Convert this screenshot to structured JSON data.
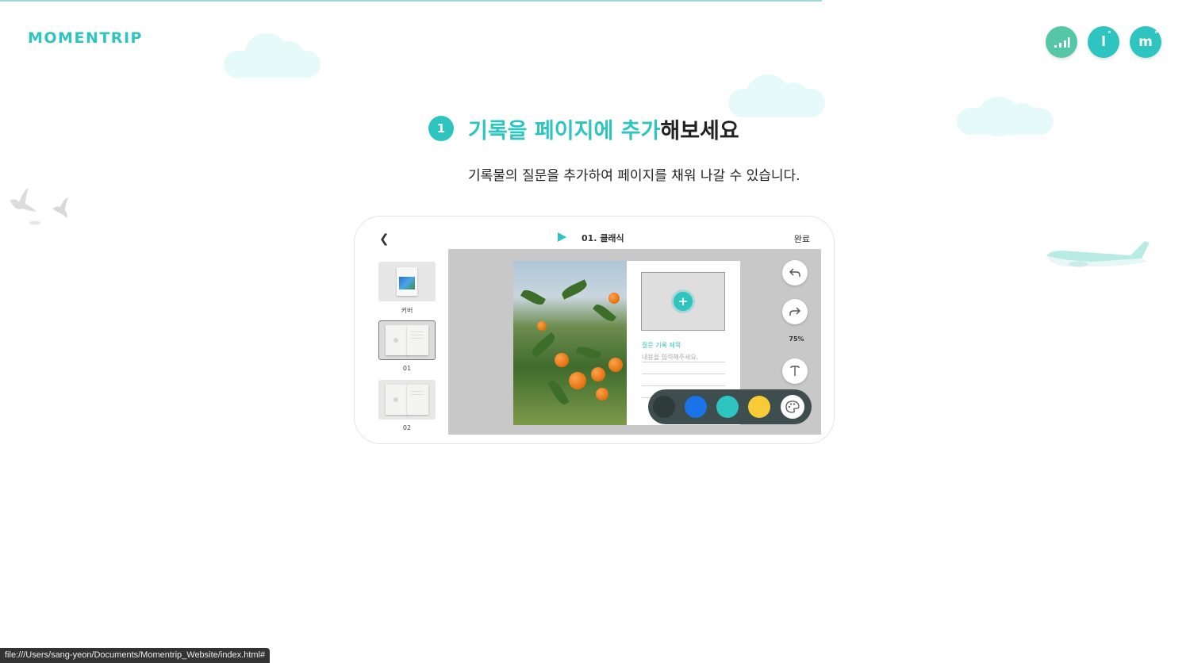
{
  "brand": {
    "logo": "MOMENTRIP"
  },
  "top_nav": {
    "stats_icon": "bar-chart-icon",
    "l_button_label": "l",
    "m_button_label": "m",
    "degree_mark": "°"
  },
  "section": {
    "step_number": "1",
    "title_highlight": "기록을 페이지에 추가",
    "title_rest": "해보세요",
    "subtitle": "기록물의 질문을 추가하여 페이지를 채워 나갈 수 있습니다."
  },
  "app": {
    "title": "01. 클래식",
    "done_label": "완료",
    "back_icon": "chevron-left-icon",
    "play_icon": "play-icon",
    "thumbnails": [
      {
        "label": "커버",
        "selected": false
      },
      {
        "label": "01",
        "selected": true
      },
      {
        "label": "02",
        "selected": false
      }
    ],
    "page": {
      "question_title": "질문 기록 제목",
      "content_placeholder": "내용을 입력해주세요.",
      "add_symbol": "+"
    },
    "tools": {
      "undo_icon": "undo-icon",
      "redo_icon": "redo-icon",
      "zoom": "75%",
      "text_icon": "text-style-icon",
      "palette_icon": "palette-icon"
    },
    "colors": [
      "#2f3b3b",
      "#1a73e8",
      "#2ec4c0",
      "#f6cb36"
    ]
  },
  "status_bar": {
    "url": "file:///Users/sang-yeon/Documents/Momentrip_Website/index.html#"
  }
}
